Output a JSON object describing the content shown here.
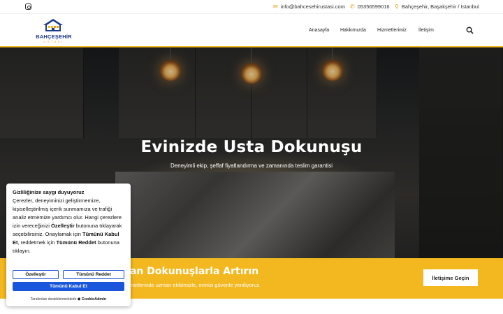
{
  "topbar": {
    "email": "info@bahcesehirustasi.com",
    "phone": "05356599016",
    "location": "Bahçeşehir, Başakşehir / İstanbul"
  },
  "logo": {
    "name": "BAHÇEŞEHİR",
    "sub": "USTASI"
  },
  "nav": {
    "items": [
      "Anasayfa",
      "Hakkımızda",
      "Hizmetlerimiz",
      "İletişim"
    ]
  },
  "hero": {
    "title": "Evinizde Usta Dokunuşu",
    "subtitle": "Deneyimli ekip, şeffaf fiyatlandırma ve zamanında teslim garantisi"
  },
  "cta": {
    "title": "nan Dokunuşlarla Artırın",
    "subtitle": "hizmetlerinde uzman ekibimizle, evinizi güvenle yeniliyoruz.",
    "button": "İletişime Geçin"
  },
  "cookie": {
    "title": "Gizliliğinize saygı duyuyoruz",
    "p1": "Çerezler, deneyiminizi geliştirmemize, kişiselleştirilmiş içerik sunmamıza ve trafiği analiz etmemize yardımcı olur. Hangi çerezlere izin vereceğinizi",
    "b1": "Özelleştir",
    "p2": " butonuna tıklayarak seçebilirsiniz. Onaylamak için ",
    "b2": "Tümünü Kabul Et",
    "p3": ", reddetmek için ",
    "b3": "Tümünü Reddet",
    "p4": " butonuna tıklayın.",
    "customize": "Özelleştir",
    "reject": "Tümünü Reddet",
    "accept": "Tümünü Kabul Et",
    "footer": "Tarafından desteklenmektedir",
    "brand": "CookieAdmin"
  },
  "colors": {
    "accent": "#f3b81f",
    "brand_blue": "#1d3b8b",
    "button_blue": "#1a56db"
  }
}
